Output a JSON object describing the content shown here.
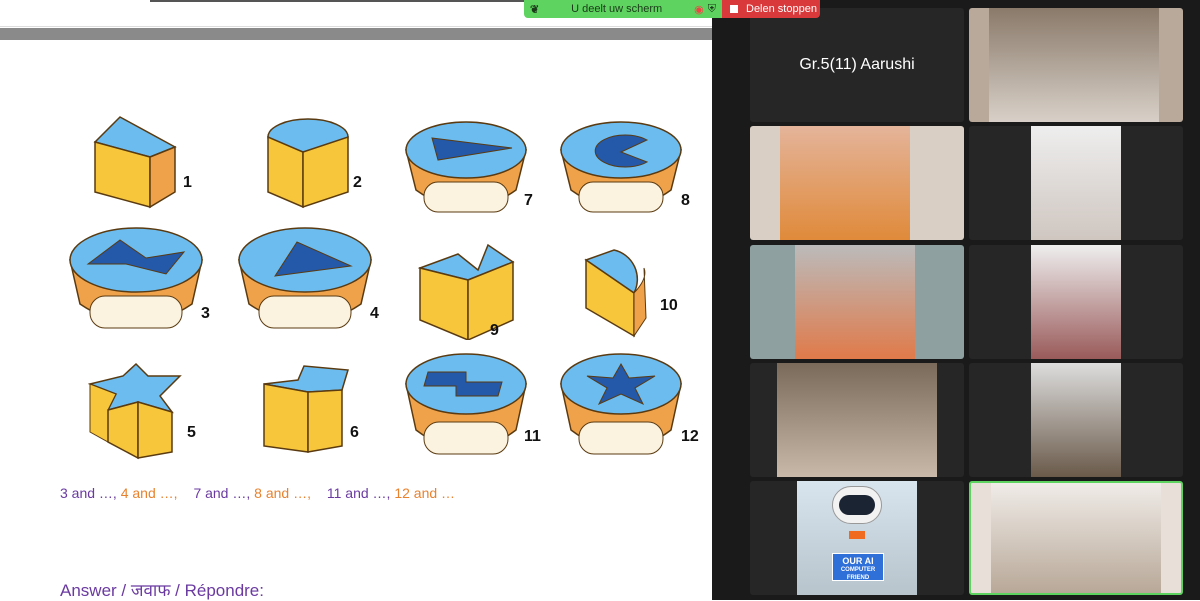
{
  "share_bar": {
    "status": "U deelt uw scherm",
    "stop_label": "Delen stoppen"
  },
  "slide": {
    "shape_numbers": [
      "1",
      "2",
      "7",
      "8",
      "3",
      "4",
      "9",
      "10",
      "5",
      "6",
      "11",
      "12"
    ],
    "pairs": [
      {
        "text": "3 and …,",
        "color": "purple"
      },
      {
        "text": "4 and …,",
        "color": "orange"
      },
      {
        "text": "7 and …,",
        "color": "purple"
      },
      {
        "text": "8 and …,",
        "color": "orange"
      },
      {
        "text": "11 and …,",
        "color": "purple"
      },
      {
        "text": "12 and …",
        "color": "orange"
      }
    ],
    "answer": "Answer / जवाफ  / Répondre:"
  },
  "participants": [
    {
      "name": "Gr.5(11) Aarushi"
    }
  ],
  "robot_sign": {
    "line1": "OUR AI",
    "line2": "COMPUTER",
    "line3": "FRIEND"
  },
  "colors": {
    "blue": "#6cbcf0",
    "yellow": "#f7c63a",
    "orange": "#f0a24a",
    "share_green": "#5fd35f",
    "share_red": "#d9393b"
  }
}
